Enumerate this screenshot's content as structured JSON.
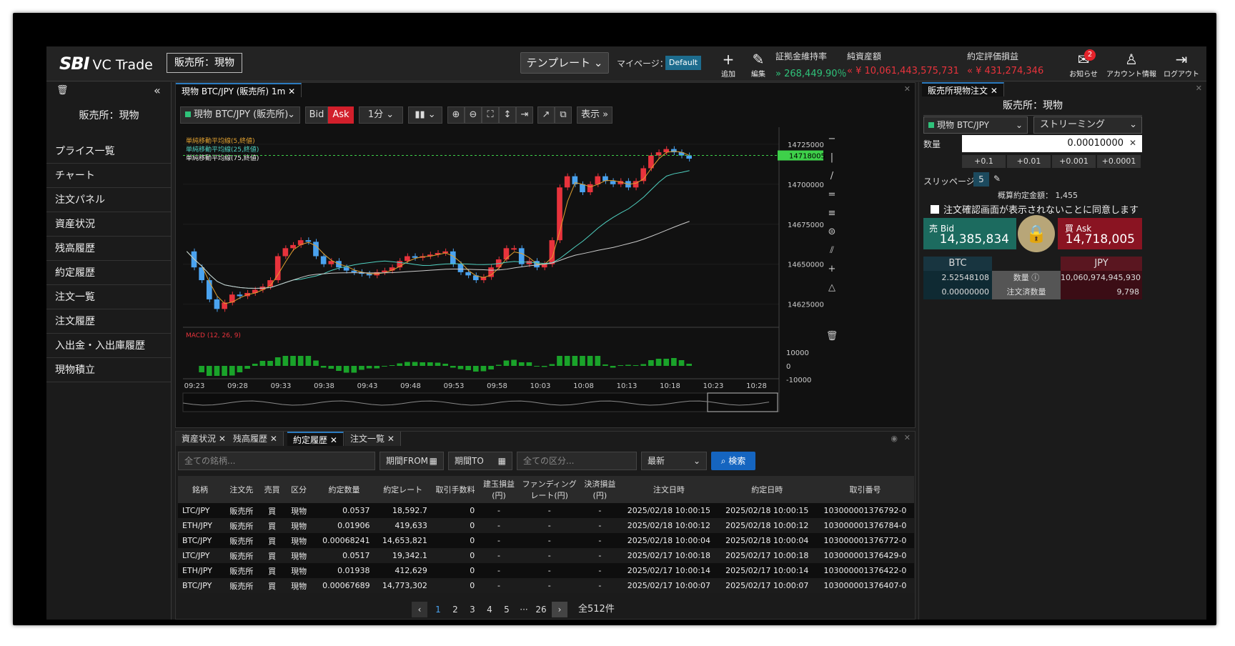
{
  "header": {
    "logo_main": "SBI",
    "logo_sub": "VC Trade",
    "exchange": "販売所：現物",
    "template": "テンプレート",
    "mypage_label": "マイページ：",
    "mypage_value": "Default",
    "add": "追加",
    "edit": "編集",
    "margin_label": "証拠金維持率",
    "margin_value": "268,449.90％",
    "net_label": "純資産額",
    "net_value": "¥ 10,061,443,575,731",
    "pnl_label": "約定評価損益",
    "pnl_value": "¥ 431,274,346",
    "notice": "お知らせ",
    "notice_count": "2",
    "account": "アカウント情報",
    "logout": "ログアウト"
  },
  "sidebar": {
    "title": "販売所：現物",
    "items": [
      "プライス一覧",
      "チャート",
      "注文パネル",
      "資産状況",
      "残高履歴",
      "約定履歴",
      "注文一覧",
      "注文履歴",
      "入出金・入出庫履歴",
      "現物積立"
    ]
  },
  "chart": {
    "tab": "現物 BTC/JPY (販売所) 1m",
    "symbol": "現物 BTC/JPY (販売所)",
    "bid": "Bid",
    "ask": "Ask",
    "interval": "1分",
    "display": "表示",
    "ma1": "単純移動平均線(5,終値)",
    "ma2": "単純移動平均線(25,終値)",
    "ma3": "単純移動平均線(75,終値)",
    "macd": "MACD (12, 26, 9)",
    "price_ticks": [
      "14725000",
      "14700000",
      "14675000",
      "14650000",
      "14625000"
    ],
    "current_price": "14718005",
    "macd_ticks": [
      "10000",
      "0",
      "-10000"
    ],
    "time_ticks": [
      "09:23",
      "09:28",
      "09:33",
      "09:38",
      "09:43",
      "09:48",
      "09:53",
      "09:58",
      "10:03",
      "10:08",
      "10:13",
      "10:18",
      "10:23",
      "10:28"
    ]
  },
  "bottom": {
    "tabs": [
      "資産状況",
      "残高履歴",
      "約定履歴",
      "注文一覧"
    ],
    "symbol_placeholder": "全ての銘柄...",
    "from": "期間FROM",
    "to": "期間TO",
    "category_placeholder": "全ての区分...",
    "sort": "最新",
    "search": "検索",
    "columns": [
      "銘柄",
      "注文先",
      "売買",
      "区分",
      "約定数量",
      "約定レート",
      "取引手数料",
      "建玉損益\n(円)",
      "ファンディング\nレート(円)",
      "決済損益\n(円)",
      "注文日時",
      "約定日時",
      "取引番号"
    ],
    "rows": [
      [
        "LTC/JPY",
        "販売所",
        "買",
        "現物",
        "0.0537",
        "18,592.7",
        "0",
        "-",
        "-",
        "-",
        "2025/02/18 10:00:15",
        "2025/02/18 10:00:15",
        "103000001376792-0"
      ],
      [
        "ETH/JPY",
        "販売所",
        "買",
        "現物",
        "0.01906",
        "419,633",
        "0",
        "-",
        "-",
        "-",
        "2025/02/18 10:00:12",
        "2025/02/18 10:00:12",
        "103000001376784-0"
      ],
      [
        "BTC/JPY",
        "販売所",
        "買",
        "現物",
        "0.00068241",
        "14,653,821",
        "0",
        "-",
        "-",
        "-",
        "2025/02/18 10:00:04",
        "2025/02/18 10:00:04",
        "103000001376772-0"
      ],
      [
        "LTC/JPY",
        "販売所",
        "買",
        "現物",
        "0.0517",
        "19,342.1",
        "0",
        "-",
        "-",
        "-",
        "2025/02/17 10:00:18",
        "2025/02/17 10:00:18",
        "103000001376429-0"
      ],
      [
        "ETH/JPY",
        "販売所",
        "買",
        "現物",
        "0.01938",
        "412,629",
        "0",
        "-",
        "-",
        "-",
        "2025/02/17 10:00:14",
        "2025/02/17 10:00:14",
        "103000001376422-0"
      ],
      [
        "BTC/JPY",
        "販売所",
        "買",
        "現物",
        "0.00067689",
        "14,773,302",
        "0",
        "-",
        "-",
        "-",
        "2025/02/17 10:00:07",
        "2025/02/17 10:00:07",
        "103000001376407-0"
      ]
    ],
    "pages": [
      "1",
      "2",
      "3",
      "4",
      "5",
      "···",
      "26"
    ],
    "total": "全512件"
  },
  "order": {
    "tab": "販売所現物注文",
    "title": "販売所：現物",
    "symbol": "現物 BTC/JPY",
    "mode": "ストリーミング",
    "qty_label": "数量",
    "qty_value": "0.00010000",
    "steps": [
      "+0.1",
      "+0.01",
      "+0.001",
      "+0.0001"
    ],
    "slip_label": "スリッページ",
    "slip_value": "5",
    "est_label": "概算約定金額：",
    "est_value": "1,455",
    "confirm": "注文確認画面が表示されないことに同意します",
    "sell_label": "売 Bid",
    "sell_price": "14,385,834",
    "buy_label": "買 Ask",
    "buy_price": "14,718,005",
    "btc": "BTC",
    "jpy": "JPY",
    "btc_qty": "2.52548108",
    "qty_mid": "数量",
    "jpy_qty": "10,060,974,945,930",
    "btc_ordered": "0.00000000",
    "ordered_mid": "注文済数量",
    "jpy_ordered": "9,798"
  },
  "colors": {
    "up": "#e8333c",
    "down": "#4aa3f0",
    "green": "#2fc27a",
    "accent": "#2b7bc0"
  }
}
